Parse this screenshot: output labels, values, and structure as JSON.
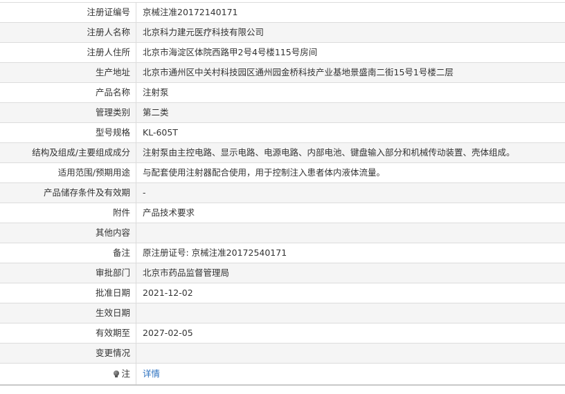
{
  "rows": [
    {
      "label": "注册证编号",
      "value": "京械注准20172140171"
    },
    {
      "label": "注册人名称",
      "value": "北京科力建元医疗科技有限公司"
    },
    {
      "label": "注册人住所",
      "value": "北京市海淀区体院西路甲2号4号楼115号房间"
    },
    {
      "label": "生产地址",
      "value": "北京市通州区中关村科技园区通州园金桥科技产业基地景盛南二街15号1号楼二层"
    },
    {
      "label": "产品名称",
      "value": "注射泵"
    },
    {
      "label": "管理类别",
      "value": "第二类"
    },
    {
      "label": "型号规格",
      "value": "KL-605T"
    },
    {
      "label": "结构及组成/主要组成成分",
      "value": "注射泵由主控电路、显示电路、电源电路、内部电池、键盘输入部分和机械传动装置、壳体组成。"
    },
    {
      "label": "适用范围/预期用途",
      "value": "与配套使用注射器配合使用，用于控制注入患者体内液体流量。"
    },
    {
      "label": "产品储存条件及有效期",
      "value": "-"
    },
    {
      "label": "附件",
      "value": "产品技术要求"
    },
    {
      "label": "其他内容",
      "value": ""
    },
    {
      "label": "备注",
      "value": "原注册证号: 京械注准20172540171"
    },
    {
      "label": "审批部门",
      "value": "北京市药品监督管理局"
    },
    {
      "label": "批准日期",
      "value": "2021-12-02"
    },
    {
      "label": "生效日期",
      "value": ""
    },
    {
      "label": "有效期至",
      "value": "2027-02-05"
    },
    {
      "label": "变更情况",
      "value": ""
    }
  ],
  "note": {
    "icon": "lightbulb-icon",
    "label": "注",
    "link_text": "详情"
  },
  "colors": {
    "border": "#dcdcdc",
    "alt_row": "#f5f5f5",
    "link": "#2a6fbf"
  }
}
